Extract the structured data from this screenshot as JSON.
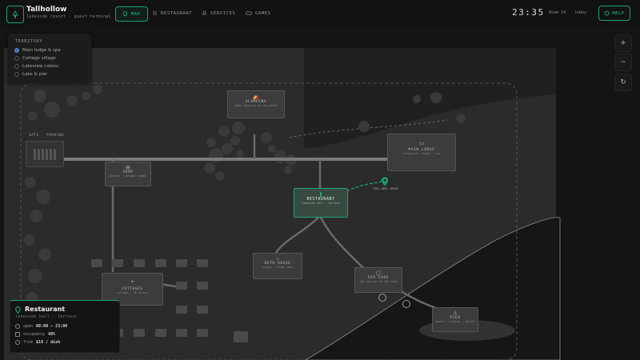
{
  "header": {
    "brand_name": "Tallhollow",
    "brand_sub": "lakeside resort · guest terminal",
    "tabs": [
      {
        "label": "MAP",
        "icon": "pin-icon",
        "active": true
      },
      {
        "label": "RESTAURANT",
        "icon": "fork-knife-icon",
        "active": false
      },
      {
        "label": "SERVICES",
        "icon": "bell-icon",
        "active": false
      },
      {
        "label": "GAMES",
        "icon": "gamepad-icon",
        "active": false
      }
    ],
    "clock": "23:35",
    "room": "Room 14",
    "lobby": "lobby",
    "help_label": "HELP"
  },
  "territory": {
    "title": "TERRITORY",
    "items": [
      {
        "label": "Main lodge & spa",
        "selected": true
      },
      {
        "label": "Cottage village",
        "selected": false
      },
      {
        "label": "Lakeview cabins",
        "selected": false
      },
      {
        "label": "Lake & pier",
        "selected": false
      }
    ]
  },
  "controls": {
    "zoom_in": "+",
    "zoom_out": "−",
    "reset": "↻"
  },
  "map": {
    "gate": "GATE",
    "parking": "PARKING",
    "glamping": {
      "title": "GLAMPING",
      "sub": "dome campsite by the woods"
    },
    "shop": {
      "title": "SHOP",
      "sub": "market · outdoor goods"
    },
    "main_lodge": {
      "title": "MAIN LODGE",
      "sub": "reception · hotel · spa"
    },
    "restaurant": {
      "title": "RESTAURANT",
      "sub": "lakeside hall · terrace"
    },
    "you_are_here": "YOU ARE HERE",
    "bath_house": {
      "title": "BATH HOUSE",
      "sub": "sauna · steam room"
    },
    "spa_lake": {
      "title": "SPA LAKE",
      "sub": "hot springs by the lake"
    },
    "cottages": {
      "title": "COTTAGES",
      "sub": "village · 18 houses"
    },
    "pier": {
      "title": "PIER",
      "sub": "boats · fishing · sunset"
    }
  },
  "info": {
    "title": "Restaurant",
    "location": "lakeside hall · terrace",
    "rows": [
      {
        "label": "open",
        "value": "08:00 — 23:00",
        "icon": "clock-icon"
      },
      {
        "label": "occupancy",
        "value": "48%",
        "icon": "people-icon"
      },
      {
        "label": "from",
        "value": "$18 / dish",
        "icon": "tag-icon"
      }
    ]
  },
  "colors": {
    "accent": "#1aa37a",
    "accent_bright": "#27c98f",
    "bg": "#141414",
    "panel": "#1c1c1c",
    "building": "#3c3c3c",
    "blue_dot": "#3b6fb0"
  }
}
